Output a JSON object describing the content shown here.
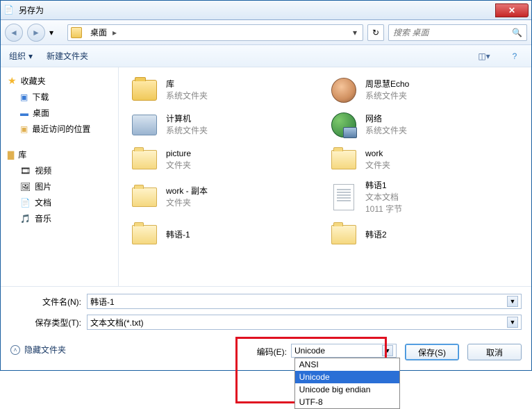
{
  "title": "另存为",
  "nav": {
    "location": "桌面",
    "search_placeholder": "搜索 桌面"
  },
  "toolbar": {
    "organize": "组织",
    "newfolder": "新建文件夹"
  },
  "sidebar": {
    "favorites": {
      "label": "收藏夹",
      "items": [
        "下载",
        "桌面",
        "最近访问的位置"
      ]
    },
    "library": {
      "label": "库",
      "items": [
        "视频",
        "图片",
        "文档",
        "音乐"
      ]
    }
  },
  "files": [
    [
      {
        "name": "库",
        "sub": "系统文件夹",
        "icon": "lib"
      },
      {
        "name": "周思慧Echo",
        "sub": "系统文件夹",
        "icon": "user"
      }
    ],
    [
      {
        "name": "计算机",
        "sub": "系统文件夹",
        "icon": "computer"
      },
      {
        "name": "网络",
        "sub": "系统文件夹",
        "icon": "network"
      }
    ],
    [
      {
        "name": "picture",
        "sub": "文件夹",
        "icon": "folder"
      },
      {
        "name": "work",
        "sub": "文件夹",
        "icon": "folder"
      }
    ],
    [
      {
        "name": "work - 副本",
        "sub": "文件夹",
        "icon": "folder"
      },
      {
        "name": "韩语1",
        "sub": "文本文档",
        "sub2": "1011 字节",
        "icon": "txt"
      }
    ],
    [
      {
        "name": "韩语-1",
        "sub": "",
        "icon": "folder"
      },
      {
        "name": "韩语2",
        "sub": "",
        "icon": "folder"
      }
    ]
  ],
  "fields": {
    "filename_label": "文件名(N):",
    "filename_value": "韩语-1",
    "filetype_label": "保存类型(T):",
    "filetype_value": "文本文档(*.txt)"
  },
  "footer": {
    "hidefolders": "隐藏文件夹",
    "encoding_label": "编码(E):",
    "encoding_value": "Unicode",
    "encoding_options": [
      "ANSI",
      "Unicode",
      "Unicode big endian",
      "UTF-8"
    ],
    "save": "保存(S)",
    "cancel": "取消"
  }
}
